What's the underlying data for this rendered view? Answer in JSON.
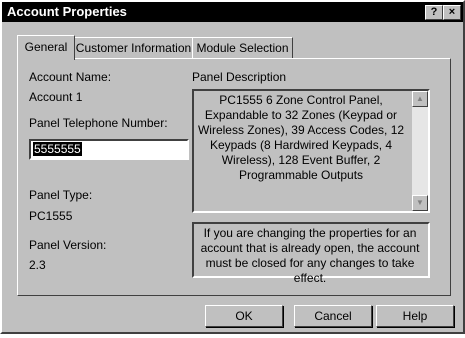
{
  "window": {
    "title": "Account Properties",
    "help_glyph": "?",
    "close_glyph": "×"
  },
  "tabs": [
    {
      "label": "General",
      "active": true
    },
    {
      "label": "Customer Information",
      "active": false
    },
    {
      "label": "Module Selection",
      "active": false
    }
  ],
  "general": {
    "account_name_label": "Account Name:",
    "account_name_value": "Account 1",
    "phone_label": "Panel Telephone Number:",
    "phone_value": "5555555",
    "panel_type_label": "Panel Type:",
    "panel_type_value": "PC1555",
    "panel_version_label": "Panel Version:",
    "panel_version_value": "2.3",
    "panel_description_label": "Panel Description",
    "panel_description": "PC1555 6 Zone Control Panel, Expandable to 32 Zones (Keypad or Wireless Zones), 39 Access Codes, 12 Keypads (8 Hardwired Keypads, 4 Wireless), 128 Event Buffer, 2 Programmable Outputs",
    "notice": "If you are changing the properties for an account that is already open, the account must be closed for any changes to take effect."
  },
  "buttons": {
    "ok": "OK",
    "cancel": "Cancel",
    "help": "Help"
  },
  "icons": {
    "scroll_up": "scroll-up-arrow-icon",
    "scroll_down": "scroll-down-arrow-icon"
  }
}
